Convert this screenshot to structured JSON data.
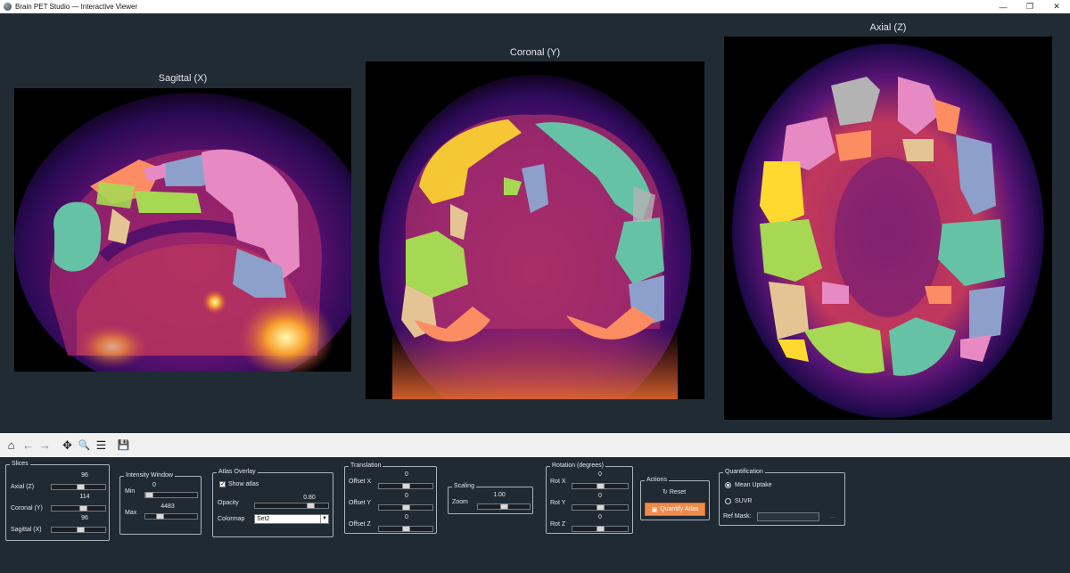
{
  "window": {
    "title": "Brain PET Studio — Interactive Viewer",
    "controls": [
      "—",
      "❐",
      "✕"
    ]
  },
  "views": {
    "sagittal": {
      "title": "Sagittal (X)"
    },
    "coronal": {
      "title": "Coronal (Y)"
    },
    "axial": {
      "title": "Axial (Z)"
    }
  },
  "toolbar": {
    "icons": [
      "home-icon",
      "back-arrow-icon",
      "forward-arrow-icon",
      "pan-icon",
      "zoom-icon",
      "configure-icon",
      "save-icon"
    ],
    "glyphs": {
      "home": "⌂",
      "back": "←",
      "forward": "→",
      "pan": "✥",
      "zoom": "🔍",
      "configure": "☰",
      "save": "💾"
    }
  },
  "slices": {
    "label": "Slices",
    "axial": {
      "label": "Axial (Z)",
      "value": "96",
      "level": 0.55
    },
    "coronal": {
      "label": "Coronal (Y)",
      "value": "114",
      "level": 0.6
    },
    "sagittal": {
      "label": "Sagittal (X)",
      "value": "96",
      "level": 0.55
    }
  },
  "intensity": {
    "label": "Intensity Window",
    "min": {
      "label": "Min",
      "value": "0",
      "level": 0.0
    },
    "max": {
      "label": "Max",
      "value": "4483",
      "level": 0.25
    }
  },
  "atlas": {
    "label": "Atlas Overlay",
    "show_label": "Show atlas",
    "show_checked": true,
    "opacity_label": "Opacity",
    "opacity_value": "0.80",
    "opacity_level": 0.8,
    "colormap_label": "Colormap",
    "colormap_value": "Set2"
  },
  "translation": {
    "label": "Translation",
    "x": {
      "label": "Offset X",
      "value": "0",
      "level": 0.5
    },
    "y": {
      "label": "Offset Y",
      "value": "0",
      "level": 0.5
    },
    "z": {
      "label": "Offset Z",
      "value": "0",
      "level": 0.5
    }
  },
  "scaling": {
    "label": "Scaling",
    "zoom": {
      "label": "Zoom",
      "value": "1.00",
      "level": 0.5
    }
  },
  "rotation": {
    "label": "Rotation (degrees)",
    "x": {
      "label": "Rot X",
      "value": "0",
      "level": 0.5
    },
    "y": {
      "label": "Rot Y",
      "value": "0",
      "level": 0.5
    },
    "z": {
      "label": "Rot Z",
      "value": "0",
      "level": 0.5
    }
  },
  "actions": {
    "label": "Actions",
    "reset_label": "Reset",
    "quantify_label": "Quantify Atlas"
  },
  "quantification": {
    "label": "Quantification",
    "mean_label": "Mean Uptake",
    "suvr_label": "SUVR",
    "selected": "mean",
    "ref_mask_label": "Ref Mask:",
    "browse_label": "..."
  },
  "colors": {
    "background": "#1f2a33",
    "accent": "#f08a4b",
    "pet_colormap": "inferno/plasma",
    "atlas_colors": [
      "#66c2a5",
      "#fc8d62",
      "#8da0cb",
      "#e78ac3",
      "#a6d854",
      "#ffd92f",
      "#e5c494",
      "#b3b3b3"
    ]
  }
}
